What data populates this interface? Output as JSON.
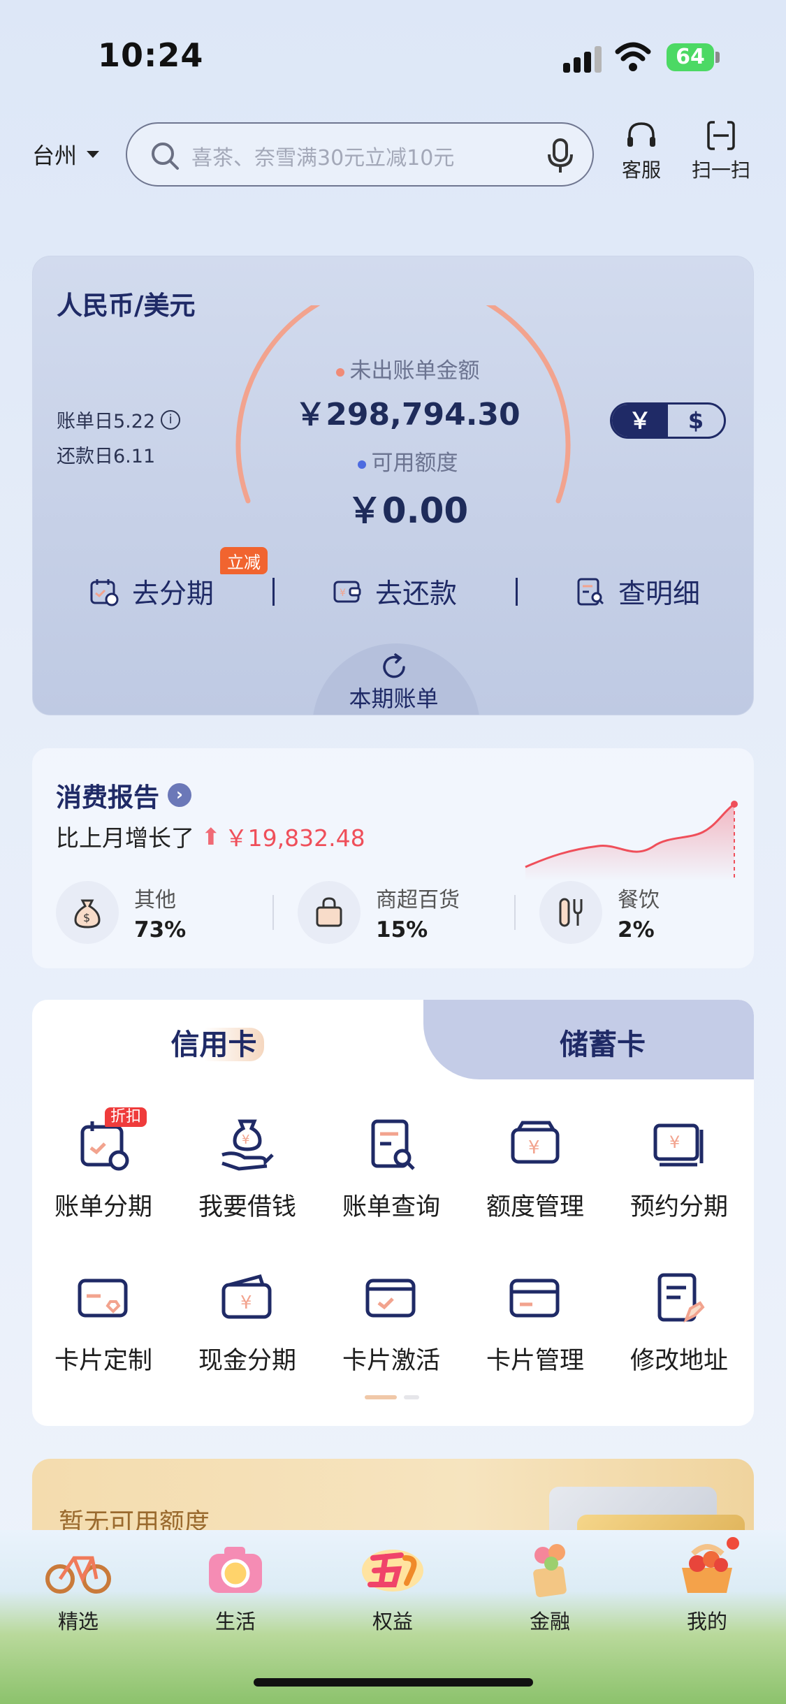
{
  "status": {
    "time": "10:24",
    "battery": "64"
  },
  "header": {
    "city": "台州",
    "search_placeholder": "喜茶、奈雪满30元立减10元",
    "service_label": "客服",
    "scan_label": "扫一扫"
  },
  "account": {
    "currency_title": "人民币/美元",
    "bill_day": "账单日5.22",
    "repay_day": "还款日6.11",
    "unbilled_label": "未出账单金额",
    "unbilled_amount": "￥298,794.30",
    "available_label": "可用额度",
    "available_amount": "￥0.00",
    "toggle_cny": "￥",
    "toggle_usd": "$",
    "actions": [
      "去分期",
      "去还款",
      "查明细"
    ],
    "installment_tag": "立减",
    "current_bill": "本期账单"
  },
  "report": {
    "title": "消费报告",
    "compare_text": "比上月增长了",
    "increase_amount": "￥19,832.48",
    "categories": [
      {
        "name": "其他",
        "pct": "73%",
        "icon": "money-bag-icon"
      },
      {
        "name": "商超百货",
        "pct": "15%",
        "icon": "shopping-bag-icon"
      },
      {
        "name": "餐饮",
        "pct": "2%",
        "icon": "utensils-icon"
      }
    ]
  },
  "cards": {
    "tab_credit": "信用卡",
    "tab_debit": "储蓄卡",
    "discount_tag": "折扣",
    "items": [
      {
        "label": "账单分期",
        "icon": "bill-calendar-icon"
      },
      {
        "label": "我要借钱",
        "icon": "hand-money-icon"
      },
      {
        "label": "账单查询",
        "icon": "bill-search-icon"
      },
      {
        "label": "额度管理",
        "icon": "wallet-yuan-icon"
      },
      {
        "label": "预约分期",
        "icon": "card-stack-icon"
      },
      {
        "label": "卡片定制",
        "icon": "card-diamond-icon"
      },
      {
        "label": "现金分期",
        "icon": "cash-wallet-icon"
      },
      {
        "label": "卡片激活",
        "icon": "card-check-icon"
      },
      {
        "label": "卡片管理",
        "icon": "card-icon"
      },
      {
        "label": "修改地址",
        "icon": "doc-edit-icon"
      }
    ]
  },
  "promo": {
    "text": "暂无可用额度"
  },
  "tabbar": {
    "items": [
      {
        "label": "精选",
        "icon": "bicycle-icon"
      },
      {
        "label": "生活",
        "icon": "camera-icon"
      },
      {
        "label": "权益",
        "icon": "wuyi-icon"
      },
      {
        "label": "金融",
        "icon": "flower-basket-icon"
      },
      {
        "label": "我的",
        "icon": "fruit-basket-icon"
      }
    ]
  },
  "colors": {
    "accent": "#1f2a66",
    "alert": "#ef4f5a",
    "gauge": "#f2a38e"
  }
}
